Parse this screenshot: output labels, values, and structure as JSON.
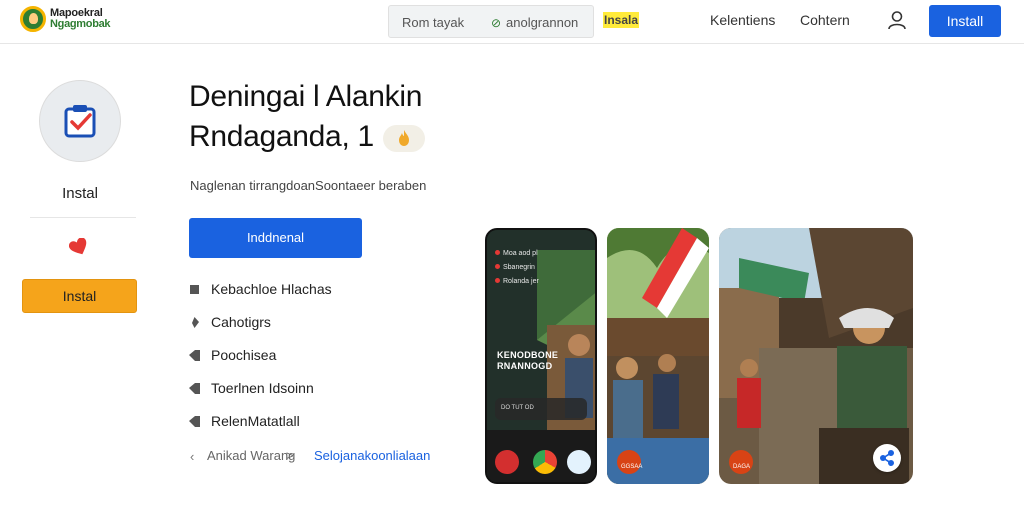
{
  "header": {
    "brand_line1": "Mapoekral",
    "brand_line2": "Ngagmobak",
    "search_text": "Rom tayak",
    "search_category": "anolgrannon",
    "highlight": "Insala",
    "nav": [
      "Kelentiens",
      "Cohtern"
    ],
    "install_label": "Install"
  },
  "sidebar": {
    "label": "Instal",
    "install_label": "Instal"
  },
  "main": {
    "title_line1": "Deningai l Alankin",
    "title_line2": "Rndaganda, 1",
    "subtitle": "Naglenan tirrangdoanSoontaeer beraben",
    "install_label": "Inddnenal",
    "features": [
      {
        "label": "Kebachloe Hlachas",
        "icon": "square-icon"
      },
      {
        "label": "Cahotigrs",
        "icon": "pin-icon"
      },
      {
        "label": "Poochisea",
        "icon": "tag-icon"
      },
      {
        "label": "Toerlnen Idsoinn",
        "icon": "tag-icon"
      },
      {
        "label": "RelenMatatlall",
        "icon": "tag-icon"
      }
    ],
    "breadcrumb": {
      "back": "Anikad Warang",
      "separator": ">",
      "current": "Selojanakoonlialaan"
    }
  },
  "screenshots": {
    "phone": {
      "notifications": [
        "Moa aod pl",
        "Sbanegrin",
        "Rolanda jer"
      ],
      "overlay_line1": "KENODBONE",
      "overlay_line2": "RNANNOGD",
      "bar_text": "DO TUT OD"
    },
    "shot2_label": "GGSAA",
    "shot3_label": "DAGA"
  },
  "colors": {
    "primary": "#1a62e0",
    "accent": "#f5a41b",
    "highlight": "#ffeb3b",
    "brand_green": "#2e7d32"
  }
}
